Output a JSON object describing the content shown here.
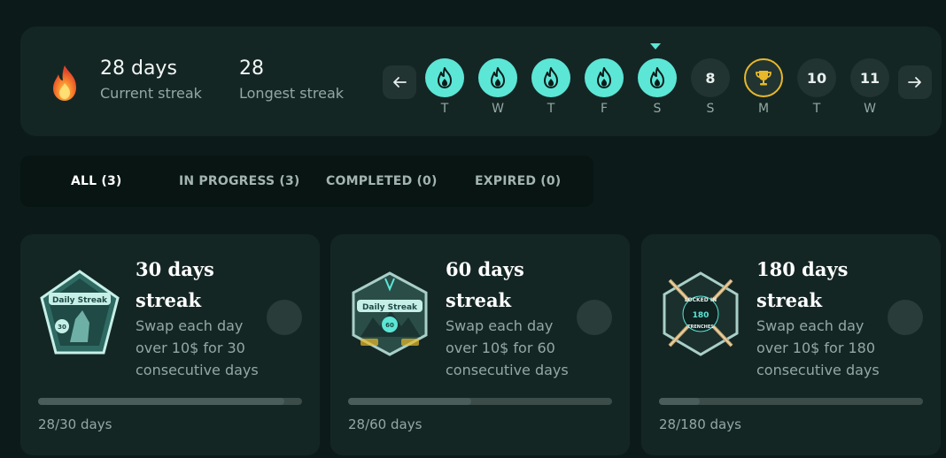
{
  "streak": {
    "current_value": "28 days",
    "current_label": "Current streak",
    "longest_value": "28",
    "longest_label": "Longest streak"
  },
  "calendar": {
    "days": [
      {
        "letter": "T",
        "state": "done",
        "number": ""
      },
      {
        "letter": "W",
        "state": "done",
        "number": ""
      },
      {
        "letter": "T",
        "state": "done",
        "number": ""
      },
      {
        "letter": "F",
        "state": "done",
        "number": ""
      },
      {
        "letter": "S",
        "state": "done",
        "number": ""
      },
      {
        "letter": "S",
        "state": "upcoming",
        "number": "8"
      },
      {
        "letter": "M",
        "state": "trophy",
        "number": ""
      },
      {
        "letter": "T",
        "state": "upcoming",
        "number": "10"
      },
      {
        "letter": "W",
        "state": "upcoming",
        "number": "11"
      }
    ]
  },
  "tabs": [
    {
      "label": "ALL (3)",
      "active": true
    },
    {
      "label": "IN PROGRESS (3)",
      "active": false
    },
    {
      "label": "COMPLETED (0)",
      "active": false
    },
    {
      "label": "EXPIRED (0)",
      "active": false
    }
  ],
  "cards": [
    {
      "title": "30 days streak",
      "description": "Swap each day over 10$ for 30 consecutive days",
      "progress_text": "28/30 days",
      "progress": 0.9333,
      "badge_text": "Daily Streak",
      "badge_number": "30"
    },
    {
      "title": "60 days streak",
      "description": "Swap each day over 10$ for 60 consecutive days",
      "progress_text": "28/60 days",
      "progress": 0.4667,
      "badge_text": "Daily Streak",
      "badge_number": "60"
    },
    {
      "title": "180 days streak",
      "description": "Swap each day over 10$ for 180 consecutive days",
      "progress_text": "28/180 days",
      "progress": 0.1556,
      "badge_text": "LOCKED IN",
      "badge_number": "180",
      "badge_subtext": "TRENCHES"
    }
  ],
  "colors": {
    "accent": "#5ce6d6",
    "trophy": "#e8b82a",
    "fire": "#f2632a",
    "background": "#0c1b19",
    "panel": "#142624"
  },
  "icons": {
    "fire": "fire-icon",
    "day_done": "flame-icon",
    "trophy": "trophy-icon",
    "prev": "arrow-left-icon",
    "next": "arrow-right-icon"
  }
}
